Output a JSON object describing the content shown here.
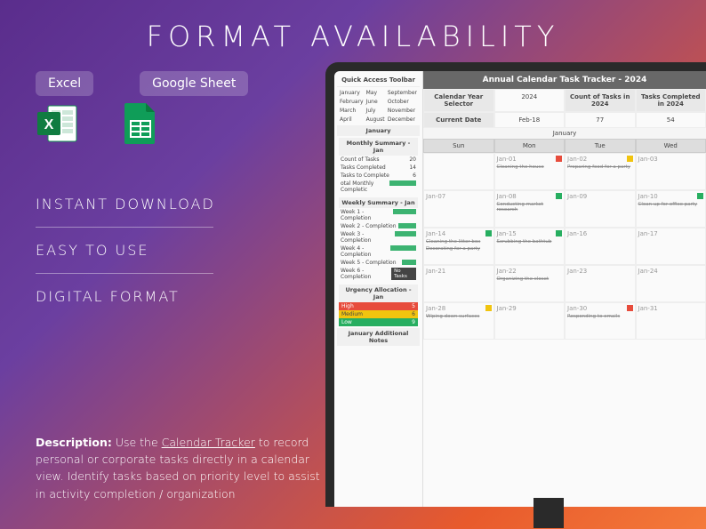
{
  "title": "FORMAT AVAILABILITY",
  "badges": {
    "excel": "Excel",
    "google": "Google Sheet"
  },
  "features": {
    "f1": "INSTANT DOWNLOAD",
    "f2": "EASY TO USE",
    "f3": "DIGITAL FORMAT"
  },
  "desc": {
    "label": "Description:",
    "text": " Use the ",
    "link": "Calendar Tracker",
    "text2": " to record personal or corporate tasks directly in a calendar view. Identify tasks based on priority level to assist in activity completion / organization"
  },
  "sheet": {
    "qat": "Quick Access Toolbar",
    "months": [
      "January",
      "May",
      "September",
      "February",
      "June",
      "October",
      "March",
      "July",
      "November",
      "April",
      "August",
      "December"
    ],
    "monthHeader": "January",
    "hdr": "Annual Calendar Task Tracker - 2024",
    "selectors": {
      "yearLabel": "Calendar Year Selector",
      "year": "2024",
      "dateLabel": "Current Date",
      "date": "Feb-18",
      "countLabel": "Count of Tasks in 2024",
      "count": "77",
      "completedLabel": "Tasks Completed in 2024",
      "completed": "54"
    },
    "monthlySummary": {
      "title": "Monthly Summary - Jan",
      "rows": [
        [
          "Count of Tasks",
          "20"
        ],
        [
          "Tasks Completed",
          "14"
        ],
        [
          "Tasks to Complete",
          "6"
        ],
        [
          "otal Monthly Completic",
          ""
        ]
      ]
    },
    "weeklySummary": {
      "title": "Weekly Summary - Jan",
      "rows": [
        "Week 1 - Completion",
        "Week 2 - Completion",
        "Week 3 - Completion",
        "Week 4 - Completion",
        "Week 5 - Completion",
        "Week 6 - Completion"
      ],
      "noTasks": "No Tasks"
    },
    "urgency": {
      "title": "Urgency Allocation - Jan",
      "rows": [
        [
          "High",
          "5"
        ],
        [
          "Medium",
          "6"
        ],
        [
          "Low",
          "9"
        ]
      ]
    },
    "notes": "January Additional Notes",
    "days": [
      "Sun",
      "Mon",
      "Tue",
      "Wed"
    ],
    "janLabel": "January",
    "cells": [
      {
        "d": "",
        "t": ""
      },
      {
        "d": "Jan-01",
        "t": "Cleaning the house",
        "c": "r"
      },
      {
        "d": "Jan-02",
        "t": "Preparing food for a party",
        "c": "y"
      },
      {
        "d": "Jan-03",
        "t": ""
      },
      {
        "d": "Jan-07",
        "t": ""
      },
      {
        "d": "Jan-08",
        "t": "Conducting market research",
        "c": "g"
      },
      {
        "d": "Jan-09",
        "t": ""
      },
      {
        "d": "Jan-10",
        "t": "Clean up for office party",
        "c": "g"
      },
      {
        "d": "Jan-14",
        "t": "Cleaning the litter box",
        "c": "g",
        "t2": "Decorating for a party",
        "c2": "g"
      },
      {
        "d": "Jan-15",
        "t": "Scrubbing the bathtub",
        "c": "g"
      },
      {
        "d": "Jan-16",
        "t": ""
      },
      {
        "d": "Jan-17",
        "t": ""
      },
      {
        "d": "Jan-21",
        "t": ""
      },
      {
        "d": "Jan-22",
        "t": "Organizing the closet",
        "c": ""
      },
      {
        "d": "Jan-23",
        "t": ""
      },
      {
        "d": "Jan-24",
        "t": ""
      },
      {
        "d": "Jan-28",
        "t": "Wiping down surfaces",
        "c": "y"
      },
      {
        "d": "Jan-29",
        "t": ""
      },
      {
        "d": "Jan-30",
        "t": "Responding to emails",
        "c": "r"
      },
      {
        "d": "Jan-31",
        "t": ""
      }
    ]
  }
}
